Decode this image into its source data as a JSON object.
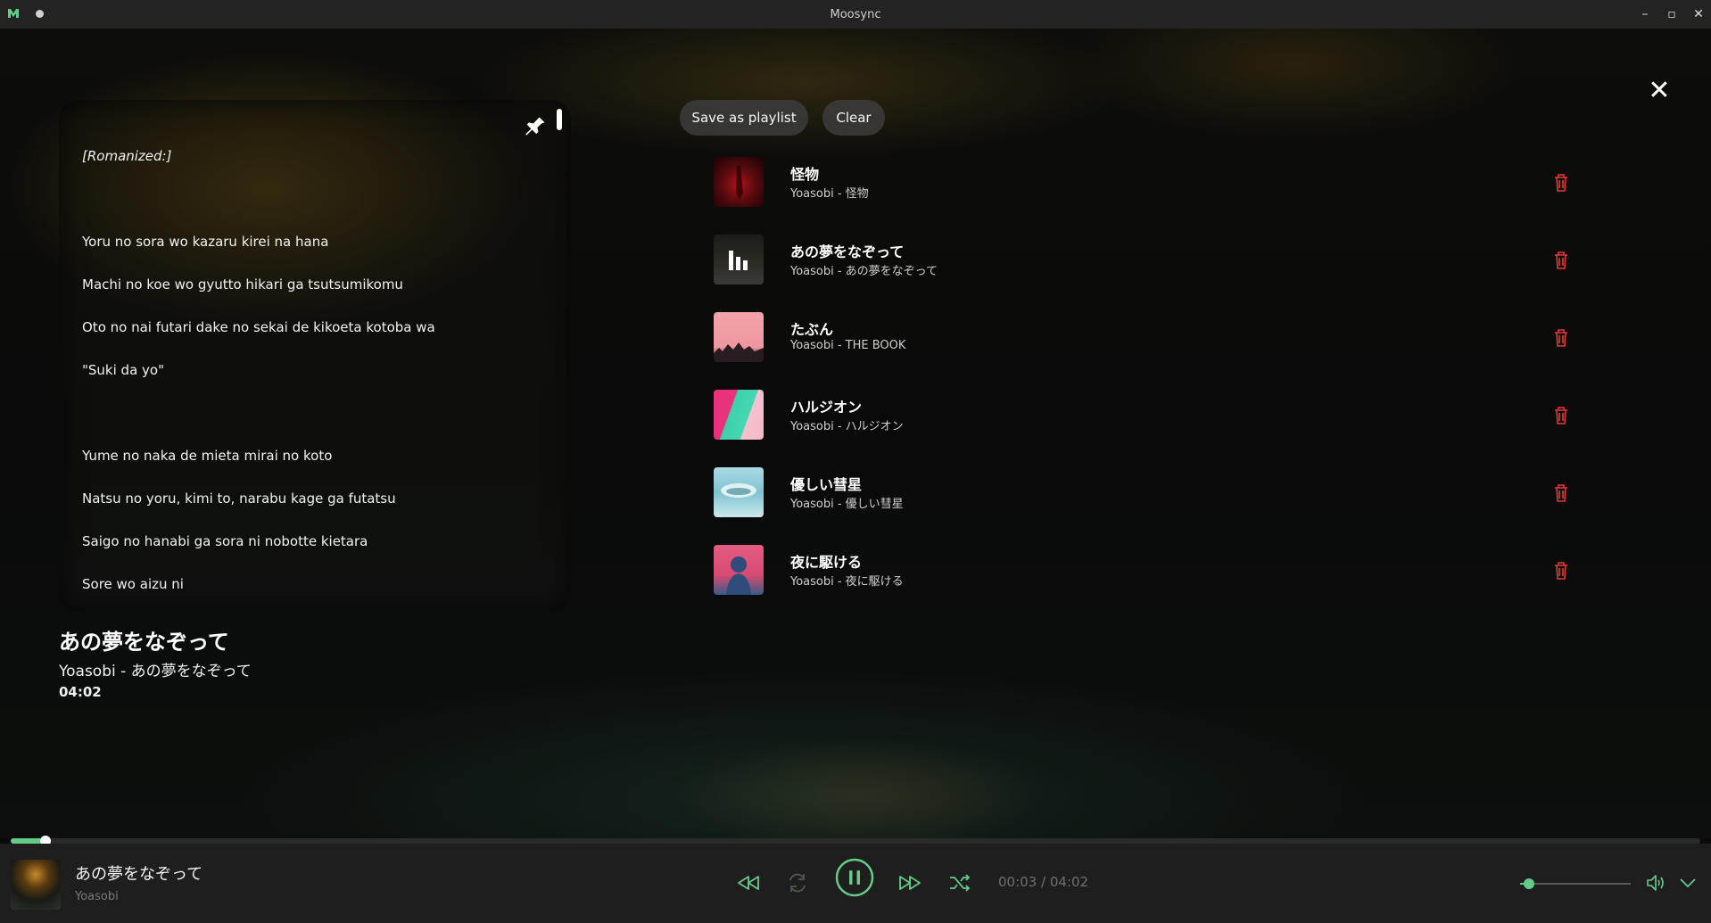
{
  "window": {
    "title": "Moosync",
    "controls": [
      "minimize-icon",
      "maximize-icon",
      "close-icon"
    ]
  },
  "lyrics": {
    "lines": [
      "[Romanized:]",
      "Yoru no sora wo kazaru kirei na hana",
      "Machi no koe wo gyutto hikari ga tsutsumikomu",
      "Oto no nai futari dake no sekai de kikoeta kotoba wa",
      "\"Suki da yo\"",
      "Yume no naka de mieta mirai no koto",
      "Natsu no yoru, kimi to, narabu kage ga futatsu",
      "Saigo no hanabi ga sora ni nobotte kietara",
      "Sore wo aizu ni"
    ]
  },
  "now_playing": {
    "title": "あの夢をなぞって",
    "subtitle": "Yoasobi - あの夢をなぞって",
    "duration": "04:02"
  },
  "queue": {
    "save_label": "Save as playlist",
    "clear_label": "Clear",
    "items": [
      {
        "title": "怪物",
        "subtitle": "Yoasobi - 怪物",
        "art": "red-dark"
      },
      {
        "title": "あの夢をなぞって",
        "subtitle": "Yoasobi - あの夢をなぞって",
        "art": "playing"
      },
      {
        "title": "たぶん",
        "subtitle": "Yoasobi - THE BOOK",
        "art": "pink-city"
      },
      {
        "title": "ハルジオン",
        "subtitle": "Yoasobi - ハルジオン",
        "art": "teal-pink"
      },
      {
        "title": "優しい彗星",
        "subtitle": "Yoasobi - 優しい彗星",
        "art": "sky-whale"
      },
      {
        "title": "夜に駆ける",
        "subtitle": "Yoasobi - 夜に駆ける",
        "art": "pink-blue"
      }
    ]
  },
  "player": {
    "title": "あの夢をなぞって",
    "artist": "Yoasobi",
    "time": "00:03 / 04:02",
    "progress": 0.012,
    "volume": 0.08,
    "accent": "#65cb88",
    "delete_color": "#e53935"
  }
}
